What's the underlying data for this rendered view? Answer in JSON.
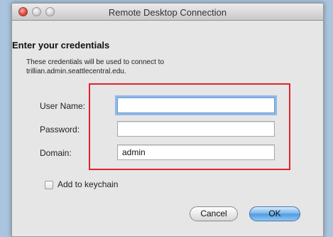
{
  "window": {
    "title": "Remote Desktop Connection"
  },
  "dialog": {
    "heading": "Enter your credentials",
    "description": "These credentials will be used to connect to trillian.admin.seattlecentral.edu.",
    "fields": {
      "username": {
        "label": "User Name:",
        "value": ""
      },
      "password": {
        "label": "Password:",
        "value": ""
      },
      "domain": {
        "label": "Domain:",
        "value": "admin"
      }
    },
    "keychain_label": "Add to keychain",
    "keychain_checked": false,
    "cancel_label": "Cancel",
    "ok_label": "OK"
  },
  "colors": {
    "highlight_border": "#e0232d",
    "ok_button": "#5fa6e6",
    "focus_ring": "#8fb8e6"
  }
}
